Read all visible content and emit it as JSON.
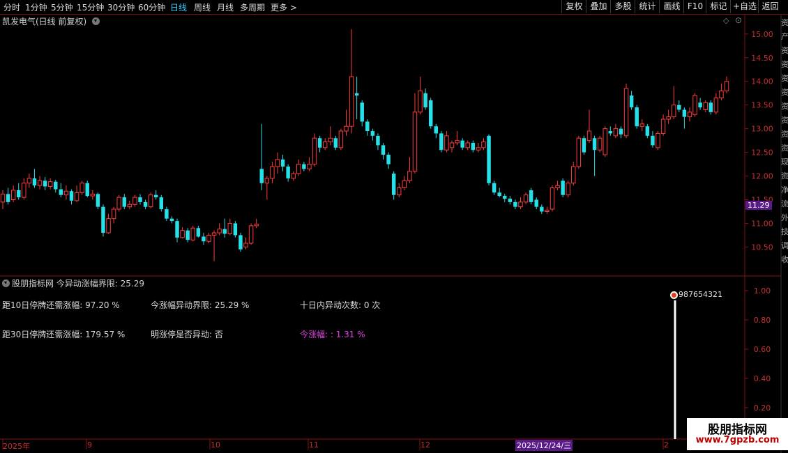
{
  "toolbar": {
    "periods": [
      "分时",
      "1分钟",
      "5分钟",
      "15分钟",
      "30分钟",
      "60分钟",
      "日线",
      "周线",
      "月线",
      "多周期",
      "更多 >"
    ],
    "active_period": "日线",
    "right_buttons": [
      "复权",
      "叠加",
      "多股",
      "统计",
      "画线",
      "F10",
      "标记",
      "+自选",
      "返回"
    ]
  },
  "main_panel": {
    "title": "凯发电气(日线 前复权)",
    "current_price": "11.29",
    "y_ticks": [
      "15.00",
      "14.50",
      "14.00",
      "13.50",
      "13.00",
      "12.50",
      "12.00",
      "11.50",
      "11.00",
      "10.50"
    ]
  },
  "indicator_panel": {
    "title": "股朋指标网 今异动涨幅界限: 25.29",
    "lines": [
      "距10日停牌还需涨幅: 97.20 %",
      "今涨幅异动界限: 25.29 %",
      "十日内异动次数: 0 次",
      "距30日停牌还需涨幅: 179.57 %",
      "明涨停是否异动: 否",
      "今涨幅: : 1.31 %"
    ],
    "marker_text": "987654321",
    "y_ticks": [
      "1.00",
      "0.80",
      "0.60",
      "0.40",
      "0.20"
    ],
    "signal_value": 1.0
  },
  "time_axis": {
    "labels": [
      "2025年",
      "9",
      "10",
      "11",
      "12",
      "2025/12/24/三",
      "2"
    ]
  },
  "watermark": {
    "line1": "股朋指标网",
    "line2": "www.7gpzb.com"
  },
  "side_text": [
    "资",
    "产",
    "资",
    "资",
    "资",
    "资",
    "资",
    "资",
    "资",
    "资",
    "现",
    "资",
    "净",
    "流",
    "外",
    "技",
    "调",
    "收"
  ],
  "colors": {
    "up": "#ff3c3c",
    "down": "#26e0e8",
    "grid_red": "#8a1010",
    "accent_blue": "#30d0ff",
    "magenta": "#e040e0",
    "price_badge": "#5a1a8a"
  },
  "chart_data": {
    "type": "candlestick",
    "title": "凯发电气(日线 前复权)",
    "ylim": [
      10.0,
      15.3
    ],
    "candles": [
      {
        "o": 11.45,
        "c": 11.62,
        "h": 11.7,
        "l": 11.3
      },
      {
        "o": 11.62,
        "c": 11.45,
        "h": 11.75,
        "l": 11.4
      },
      {
        "o": 11.5,
        "c": 11.7,
        "h": 11.8,
        "l": 11.45
      },
      {
        "o": 11.7,
        "c": 11.55,
        "h": 11.85,
        "l": 11.5
      },
      {
        "o": 11.55,
        "c": 11.85,
        "h": 11.95,
        "l": 11.5
      },
      {
        "o": 11.85,
        "c": 11.95,
        "h": 12.05,
        "l": 11.75
      },
      {
        "o": 11.95,
        "c": 11.8,
        "h": 12.15,
        "l": 11.75
      },
      {
        "o": 11.8,
        "c": 11.9,
        "h": 12.0,
        "l": 11.72
      },
      {
        "o": 11.9,
        "c": 11.78,
        "h": 11.98,
        "l": 11.7
      },
      {
        "o": 11.78,
        "c": 11.88,
        "h": 11.95,
        "l": 11.72
      },
      {
        "o": 11.88,
        "c": 11.72,
        "h": 11.92,
        "l": 11.65
      },
      {
        "o": 11.72,
        "c": 11.6,
        "h": 11.85,
        "l": 11.55
      },
      {
        "o": 11.6,
        "c": 11.68,
        "h": 11.8,
        "l": 11.5
      },
      {
        "o": 11.68,
        "c": 11.48,
        "h": 11.72,
        "l": 11.4
      },
      {
        "o": 11.48,
        "c": 11.65,
        "h": 11.8,
        "l": 11.45
      },
      {
        "o": 11.65,
        "c": 11.85,
        "h": 11.9,
        "l": 11.6
      },
      {
        "o": 11.85,
        "c": 11.58,
        "h": 11.9,
        "l": 11.55
      },
      {
        "o": 11.58,
        "c": 11.62,
        "h": 11.7,
        "l": 11.5
      },
      {
        "o": 11.62,
        "c": 11.35,
        "h": 11.65,
        "l": 11.3
      },
      {
        "o": 11.35,
        "c": 10.8,
        "h": 11.4,
        "l": 10.72
      },
      {
        "o": 10.8,
        "c": 11.1,
        "h": 11.2,
        "l": 10.78
      },
      {
        "o": 11.1,
        "c": 11.3,
        "h": 11.35,
        "l": 11.0
      },
      {
        "o": 11.3,
        "c": 11.55,
        "h": 11.6,
        "l": 11.25
      },
      {
        "o": 11.55,
        "c": 11.35,
        "h": 11.62,
        "l": 11.3
      },
      {
        "o": 11.35,
        "c": 11.4,
        "h": 11.48,
        "l": 11.3
      },
      {
        "o": 11.4,
        "c": 11.55,
        "h": 11.6,
        "l": 11.35
      },
      {
        "o": 11.55,
        "c": 11.45,
        "h": 11.62,
        "l": 11.4
      },
      {
        "o": 11.45,
        "c": 11.35,
        "h": 11.5,
        "l": 11.3
      },
      {
        "o": 11.35,
        "c": 11.6,
        "h": 11.65,
        "l": 11.32
      },
      {
        "o": 11.6,
        "c": 11.55,
        "h": 11.7,
        "l": 11.5
      },
      {
        "o": 11.55,
        "c": 11.3,
        "h": 11.6,
        "l": 11.25
      },
      {
        "o": 11.3,
        "c": 11.1,
        "h": 11.35,
        "l": 11.05
      },
      {
        "o": 11.1,
        "c": 11.05,
        "h": 11.15,
        "l": 11.0
      },
      {
        "o": 11.05,
        "c": 10.7,
        "h": 11.1,
        "l": 10.6
      },
      {
        "o": 10.7,
        "c": 10.85,
        "h": 10.92,
        "l": 10.68
      },
      {
        "o": 10.85,
        "c": 10.65,
        "h": 10.9,
        "l": 10.6
      },
      {
        "o": 10.65,
        "c": 10.9,
        "h": 10.95,
        "l": 10.62
      },
      {
        "o": 10.9,
        "c": 10.72,
        "h": 10.95,
        "l": 10.7
      },
      {
        "o": 10.72,
        "c": 10.62,
        "h": 10.8,
        "l": 10.55
      },
      {
        "o": 10.62,
        "c": 10.75,
        "h": 10.8,
        "l": 10.58
      },
      {
        "o": 10.75,
        "c": 10.8,
        "h": 10.85,
        "l": 10.2
      },
      {
        "o": 10.8,
        "c": 10.88,
        "h": 11.0,
        "l": 10.75
      },
      {
        "o": 10.88,
        "c": 10.78,
        "h": 11.1,
        "l": 10.7
      },
      {
        "o": 10.78,
        "c": 11.0,
        "h": 11.1,
        "l": 10.75
      },
      {
        "o": 11.0,
        "c": 10.75,
        "h": 11.05,
        "l": 10.7
      },
      {
        "o": 10.75,
        "c": 10.45,
        "h": 10.8,
        "l": 10.4
      },
      {
        "o": 10.5,
        "c": 10.58,
        "h": 10.7,
        "l": 10.45
      },
      {
        "o": 10.58,
        "c": 10.95,
        "h": 11.0,
        "l": 10.55
      },
      {
        "o": 10.95,
        "c": 10.98,
        "h": 11.1,
        "l": 10.9
      },
      {
        "o": 12.15,
        "c": 11.85,
        "h": 13.1,
        "l": 11.7
      },
      {
        "o": 11.85,
        "c": 11.95,
        "h": 12.0,
        "l": 11.5
      },
      {
        "o": 11.95,
        "c": 12.2,
        "h": 12.3,
        "l": 11.85
      },
      {
        "o": 12.2,
        "c": 12.35,
        "h": 12.5,
        "l": 12.05
      },
      {
        "o": 12.35,
        "c": 12.2,
        "h": 12.45,
        "l": 12.1
      },
      {
        "o": 12.2,
        "c": 11.95,
        "h": 12.25,
        "l": 11.88
      },
      {
        "o": 11.95,
        "c": 12.05,
        "h": 12.1,
        "l": 11.9
      },
      {
        "o": 12.05,
        "c": 12.25,
        "h": 12.35,
        "l": 12.0
      },
      {
        "o": 12.25,
        "c": 12.15,
        "h": 12.3,
        "l": 12.1
      },
      {
        "o": 12.15,
        "c": 12.25,
        "h": 12.4,
        "l": 12.1
      },
      {
        "o": 12.25,
        "c": 12.8,
        "h": 12.9,
        "l": 12.2
      },
      {
        "o": 12.8,
        "c": 12.6,
        "h": 12.85,
        "l": 12.5
      },
      {
        "o": 12.6,
        "c": 12.72,
        "h": 12.8,
        "l": 12.55
      },
      {
        "o": 12.72,
        "c": 12.8,
        "h": 13.05,
        "l": 12.65
      },
      {
        "o": 12.8,
        "c": 12.6,
        "h": 12.85,
        "l": 12.55
      },
      {
        "o": 12.6,
        "c": 12.95,
        "h": 13.0,
        "l": 12.55
      },
      {
        "o": 12.95,
        "c": 13.05,
        "h": 13.4,
        "l": 12.85
      },
      {
        "o": 13.05,
        "c": 14.1,
        "h": 15.1,
        "l": 12.9
      },
      {
        "o": 13.75,
        "c": 13.7,
        "h": 14.1,
        "l": 13.2
      },
      {
        "o": 13.55,
        "c": 13.15,
        "h": 13.6,
        "l": 13.05
      },
      {
        "o": 13.15,
        "c": 12.95,
        "h": 13.2,
        "l": 12.85
      },
      {
        "o": 12.95,
        "c": 12.85,
        "h": 13.0,
        "l": 12.75
      },
      {
        "o": 12.85,
        "c": 12.65,
        "h": 12.9,
        "l": 12.55
      },
      {
        "o": 12.65,
        "c": 12.45,
        "h": 12.7,
        "l": 12.35
      },
      {
        "o": 12.45,
        "c": 12.25,
        "h": 12.5,
        "l": 12.15
      },
      {
        "o": 12.05,
        "c": 11.6,
        "h": 12.1,
        "l": 11.5
      },
      {
        "o": 11.6,
        "c": 11.75,
        "h": 11.85,
        "l": 11.55
      },
      {
        "o": 11.75,
        "c": 11.9,
        "h": 12.0,
        "l": 11.7
      },
      {
        "o": 11.9,
        "c": 12.1,
        "h": 12.4,
        "l": 11.85
      },
      {
        "o": 12.1,
        "c": 13.35,
        "h": 13.75,
        "l": 12.05
      },
      {
        "o": 13.35,
        "c": 13.8,
        "h": 14.1,
        "l": 13.3
      },
      {
        "o": 13.75,
        "c": 13.45,
        "h": 13.85,
        "l": 13.4
      },
      {
        "o": 13.6,
        "c": 13.05,
        "h": 13.65,
        "l": 13.0
      },
      {
        "o": 13.05,
        "c": 12.9,
        "h": 13.1,
        "l": 12.8
      },
      {
        "o": 12.9,
        "c": 12.55,
        "h": 12.95,
        "l": 12.5
      },
      {
        "o": 12.55,
        "c": 12.85,
        "h": 12.95,
        "l": 12.5
      },
      {
        "o": 12.6,
        "c": 12.7,
        "h": 12.75,
        "l": 12.5
      },
      {
        "o": 12.7,
        "c": 12.75,
        "h": 12.95,
        "l": 12.65
      },
      {
        "o": 12.75,
        "c": 12.6,
        "h": 12.8,
        "l": 12.55
      },
      {
        "o": 12.6,
        "c": 12.7,
        "h": 12.75,
        "l": 12.55
      },
      {
        "o": 12.7,
        "c": 12.55,
        "h": 12.75,
        "l": 12.5
      },
      {
        "o": 12.55,
        "c": 12.6,
        "h": 12.7,
        "l": 12.5
      },
      {
        "o": 12.6,
        "c": 12.72,
        "h": 12.8,
        "l": 12.55
      },
      {
        "o": 12.85,
        "c": 11.85,
        "h": 12.88,
        "l": 11.8
      },
      {
        "o": 11.85,
        "c": 11.65,
        "h": 11.9,
        "l": 11.6
      },
      {
        "o": 11.65,
        "c": 11.58,
        "h": 11.75,
        "l": 11.55
      },
      {
        "o": 11.58,
        "c": 11.52,
        "h": 11.62,
        "l": 11.45
      },
      {
        "o": 11.52,
        "c": 11.45,
        "h": 11.58,
        "l": 11.4
      },
      {
        "o": 11.45,
        "c": 11.35,
        "h": 11.5,
        "l": 11.3
      },
      {
        "o": 11.35,
        "c": 11.45,
        "h": 11.55,
        "l": 11.3
      },
      {
        "o": 11.45,
        "c": 11.6,
        "h": 11.65,
        "l": 11.4
      },
      {
        "o": 11.7,
        "c": 11.45,
        "h": 11.75,
        "l": 11.4
      },
      {
        "o": 11.5,
        "c": 11.35,
        "h": 11.55,
        "l": 11.3
      },
      {
        "o": 11.35,
        "c": 11.25,
        "h": 11.4,
        "l": 11.2
      },
      {
        "o": 11.25,
        "c": 11.28,
        "h": 11.35,
        "l": 11.2
      },
      {
        "o": 11.3,
        "c": 11.75,
        "h": 11.8,
        "l": 11.25
      },
      {
        "o": 11.75,
        "c": 11.8,
        "h": 11.9,
        "l": 11.7
      },
      {
        "o": 11.9,
        "c": 11.6,
        "h": 11.95,
        "l": 11.55
      },
      {
        "o": 11.6,
        "c": 11.85,
        "h": 11.9,
        "l": 11.55
      },
      {
        "o": 11.85,
        "c": 12.2,
        "h": 12.3,
        "l": 11.8
      },
      {
        "o": 12.2,
        "c": 12.8,
        "h": 12.85,
        "l": 12.15
      },
      {
        "o": 12.8,
        "c": 12.5,
        "h": 12.85,
        "l": 12.45
      },
      {
        "o": 12.75,
        "c": 12.95,
        "h": 13.4,
        "l": 12.7
      },
      {
        "o": 12.8,
        "c": 12.55,
        "h": 12.85,
        "l": 12.0
      },
      {
        "o": 12.55,
        "c": 12.8,
        "h": 12.85,
        "l": 12.5
      },
      {
        "o": 12.45,
        "c": 13.0,
        "h": 13.05,
        "l": 12.4
      },
      {
        "o": 12.95,
        "c": 12.9,
        "h": 13.05,
        "l": 12.85
      },
      {
        "o": 12.85,
        "c": 13.0,
        "h": 13.1,
        "l": 12.8
      },
      {
        "o": 13.0,
        "c": 12.88,
        "h": 13.05,
        "l": 12.8
      },
      {
        "o": 12.85,
        "c": 13.85,
        "h": 13.95,
        "l": 12.8
      },
      {
        "o": 13.7,
        "c": 13.45,
        "h": 13.8,
        "l": 13.4
      },
      {
        "o": 13.45,
        "c": 13.05,
        "h": 13.5,
        "l": 13.0
      },
      {
        "o": 13.05,
        "c": 13.1,
        "h": 13.2,
        "l": 12.95
      },
      {
        "o": 13.05,
        "c": 12.85,
        "h": 13.1,
        "l": 12.8
      },
      {
        "o": 12.85,
        "c": 12.65,
        "h": 12.95,
        "l": 12.6
      },
      {
        "o": 12.6,
        "c": 12.9,
        "h": 12.95,
        "l": 12.55
      },
      {
        "o": 12.9,
        "c": 13.2,
        "h": 13.3,
        "l": 12.85
      },
      {
        "o": 13.2,
        "c": 13.25,
        "h": 13.4,
        "l": 13.1
      },
      {
        "o": 13.25,
        "c": 13.5,
        "h": 13.9,
        "l": 13.2
      },
      {
        "o": 13.5,
        "c": 13.4,
        "h": 13.6,
        "l": 13.35
      },
      {
        "o": 13.4,
        "c": 13.25,
        "h": 13.45,
        "l": 13.0
      },
      {
        "o": 13.25,
        "c": 13.35,
        "h": 13.45,
        "l": 13.15
      },
      {
        "o": 13.3,
        "c": 13.7,
        "h": 13.75,
        "l": 13.25
      },
      {
        "o": 13.55,
        "c": 13.45,
        "h": 13.65,
        "l": 13.4
      },
      {
        "o": 13.4,
        "c": 13.55,
        "h": 13.6,
        "l": 13.35
      },
      {
        "o": 13.55,
        "c": 13.35,
        "h": 13.6,
        "l": 13.3
      },
      {
        "o": 13.35,
        "c": 13.65,
        "h": 13.75,
        "l": 13.3
      },
      {
        "o": 13.65,
        "c": 13.8,
        "h": 13.95,
        "l": 13.6
      },
      {
        "o": 13.8,
        "c": 14.0,
        "h": 14.1,
        "l": 13.75
      }
    ]
  }
}
